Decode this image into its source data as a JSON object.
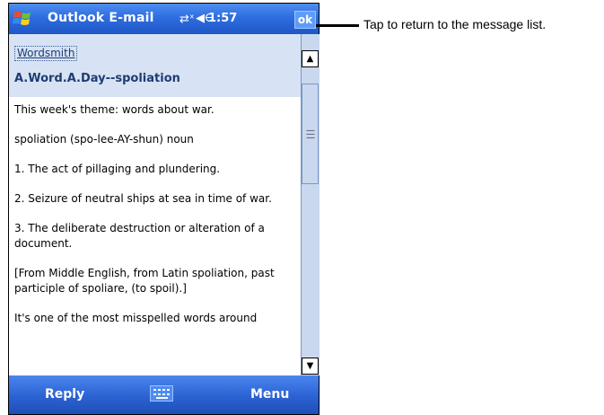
{
  "titlebar": {
    "app_title": "Outlook E-mail",
    "time": "1:57",
    "ok_label": "ok",
    "icons": [
      "windows-start-icon",
      "signal-icon",
      "speaker-icon"
    ]
  },
  "message": {
    "sender": "Wordsmith",
    "subject": "A.Word.A.Day--spoliation",
    "body": [
      "This week's theme: words about war.",
      "spoliation (spo-lee-AY-shun) noun",
      "1. The act of pillaging and plundering.",
      "2. Seizure of neutral ships at sea in time of war.",
      "3. The deliberate destruction or alteration of a document.",
      "[From Middle English, from Latin spoliation, past participle of spoliare, (to spoil).]",
      "It's one of the most misspelled words around"
    ]
  },
  "menubar": {
    "left_label": "Reply",
    "right_label": "Menu"
  },
  "callout": {
    "text": "Tap to return to the message list."
  },
  "colors": {
    "titlebar": "#2e6de0",
    "header_bg": "#d7e3f4",
    "scrollbar_bg": "#c9d8ee"
  }
}
